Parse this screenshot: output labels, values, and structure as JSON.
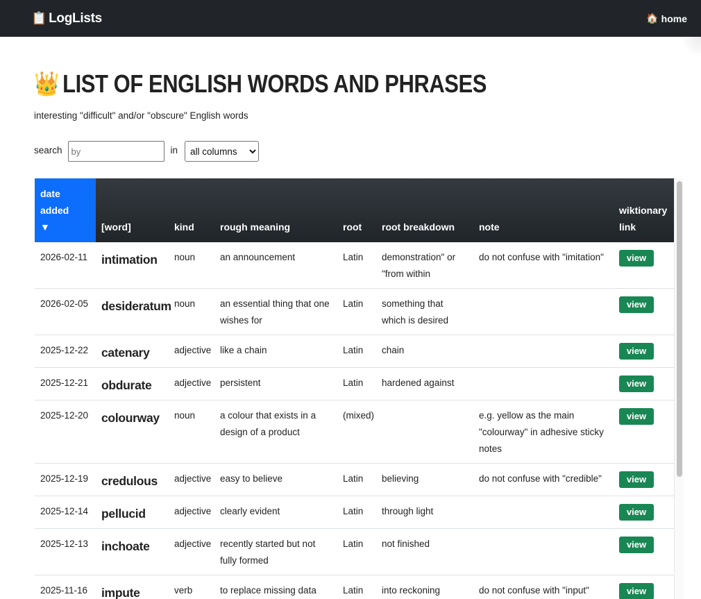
{
  "nav": {
    "brand": "LogLists",
    "brand_icon": "📋",
    "home_icon": "🏠",
    "home_label": "home"
  },
  "page": {
    "title_icon": "👑",
    "title": "LIST OF ENGLISH WORDS AND PHRASES",
    "subtitle": "interesting \"difficult\" and/or \"obscure\" English words"
  },
  "search": {
    "label": "search",
    "placeholder": "by",
    "in_label": "in",
    "scope_selected": "all columns"
  },
  "table": {
    "headers": {
      "date": "date added",
      "sort_indicator": "▼",
      "word": "[word]",
      "kind": "kind",
      "meaning": "rough meaning",
      "root": "root",
      "breakdown": "root breakdown",
      "note": "note",
      "link": "wiktionary link"
    },
    "view_label": "view",
    "rows": [
      {
        "date": "2026-02-11",
        "word": "intimation",
        "kind": "noun",
        "meaning": "an announcement",
        "root": "Latin",
        "breakdown": "demonstration\" or \"from within",
        "note": "do not confuse with \"imitation\""
      },
      {
        "date": "2026-02-05",
        "word": "desideratum",
        "kind": "noun",
        "meaning": "an essential thing that one wishes for",
        "root": "Latin",
        "breakdown": "something that which is desired",
        "note": ""
      },
      {
        "date": "2025-12-22",
        "word": "catenary",
        "kind": "adjective",
        "meaning": "like a chain",
        "root": "Latin",
        "breakdown": "chain",
        "note": ""
      },
      {
        "date": "2025-12-21",
        "word": "obdurate",
        "kind": "adjective",
        "meaning": "persistent",
        "root": "Latin",
        "breakdown": "hardened against",
        "note": ""
      },
      {
        "date": "2025-12-20",
        "word": "colourway",
        "kind": "noun",
        "meaning": "a colour that exists in a design of a product",
        "root": "(mixed)",
        "breakdown": "",
        "note": "e.g. yellow as the main \"colourway\" in adhesive sticky notes"
      },
      {
        "date": "2025-12-19",
        "word": "credulous",
        "kind": "adjective",
        "meaning": "easy to believe",
        "root": "Latin",
        "breakdown": "believing",
        "note": "do not confuse with \"credible\""
      },
      {
        "date": "2025-12-14",
        "word": "pellucid",
        "kind": "adjective",
        "meaning": "clearly evident",
        "root": "Latin",
        "breakdown": "through light",
        "note": ""
      },
      {
        "date": "2025-12-13",
        "word": "inchoate",
        "kind": "adjective",
        "meaning": "recently started but not fully formed",
        "root": "Latin",
        "breakdown": "not finished",
        "note": ""
      },
      {
        "date": "2025-11-16",
        "word": "impute",
        "kind": "verb",
        "meaning": "to replace missing data with substituted values",
        "root": "Latin",
        "breakdown": "into reckoning",
        "note": "do not confuse with \"input\""
      }
    ]
  }
}
